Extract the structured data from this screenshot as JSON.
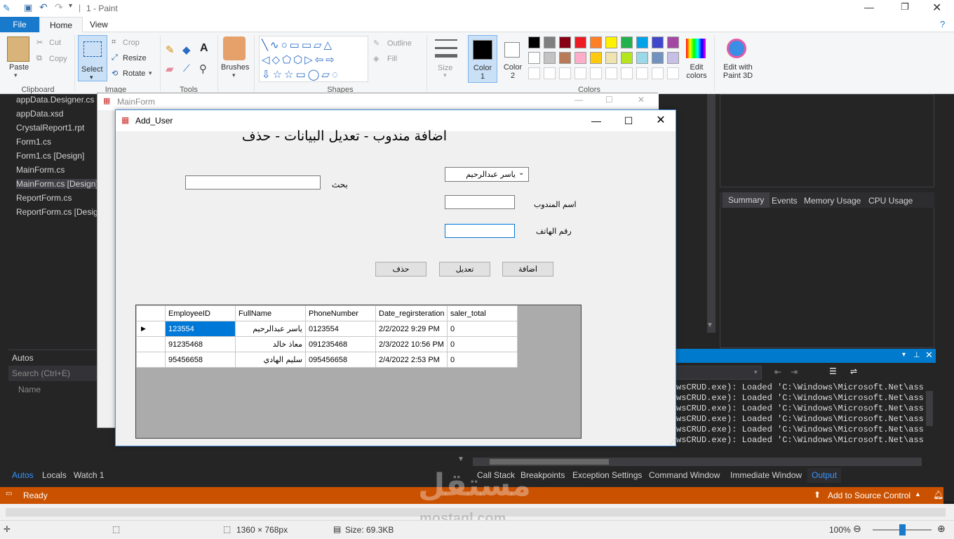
{
  "app": {
    "title": "1 - Paint"
  },
  "ribbon": {
    "tabs": [
      "File",
      "Home",
      "View"
    ],
    "clipboard": {
      "paste": "Paste",
      "cut": "Cut",
      "copy": "Copy",
      "label": "Clipboard"
    },
    "image": {
      "select": "Select",
      "crop": "Crop",
      "resize": "Resize",
      "rotate": "Rotate",
      "label": "Image"
    },
    "tools": {
      "label": "Tools"
    },
    "brushes": "Brushes",
    "shapes": {
      "label": "Shapes",
      "outline": "Outline",
      "fill": "Fill"
    },
    "size": "Size",
    "color1": "Color 1",
    "color2": "Color 2",
    "colors_label": "Colors",
    "edit_colors": "Edit colors",
    "edit_paint3d": "Edit with Paint 3D",
    "palette_row1": [
      "#000000",
      "#7f7f7f",
      "#880015",
      "#ed1c24",
      "#ff7f27",
      "#fff200",
      "#22b14c",
      "#00a2e8",
      "#3f48cc",
      "#a349a4"
    ],
    "palette_row2": [
      "#ffffff",
      "#c3c3c3",
      "#b97a57",
      "#ffaec9",
      "#ffc90e",
      "#efe4b0",
      "#b5e61d",
      "#99d9ea",
      "#7092be",
      "#c8bfe7"
    ]
  },
  "solution": {
    "files": [
      "appData.Designer.cs",
      "appData.xsd",
      "CrystalReport1.rpt",
      "Form1.cs",
      "Form1.cs [Design]",
      "MainForm.cs",
      "MainForm.cs [Design]",
      "ReportForm.cs",
      "ReportForm.cs [Design]"
    ]
  },
  "autos": {
    "title": "Autos",
    "search": "Search (Ctrl+E)",
    "col_name": "Name",
    "tabs": [
      "Autos",
      "Locals",
      "Watch 1"
    ]
  },
  "diag": {
    "tabs": [
      "Summary",
      "Events",
      "Memory Usage",
      "CPU Usage"
    ]
  },
  "mainform": {
    "title": "MainForm"
  },
  "adduser": {
    "title": "Add_User",
    "heading": "اضافة مندوب - تعديل البيانات - حذف",
    "search_label": "بحث",
    "combo_value": "ياسر عبدالرحيم",
    "name_label": "اسم المندوب",
    "phone_label": "رقم الهاتف",
    "btn_delete": "حذف",
    "btn_edit": "تعديل",
    "btn_add": "اضافة",
    "columns": [
      "EmployeeID",
      "FullName",
      "PhoneNumber",
      "Date_regirsteration",
      "saler_total"
    ],
    "rows": [
      [
        "123554",
        "ياسر عبدالرحيم",
        "0123554",
        "2/2/2022 9:29 PM",
        "0"
      ],
      [
        "91235468",
        "معاذ خالد",
        "091235468",
        "2/3/2022 10:56 PM",
        "0"
      ],
      [
        "95456658",
        "سليم الهادي",
        "095456658",
        "2/4/2022 2:53 PM",
        "0"
      ]
    ]
  },
  "output": {
    "lines": [
      "wsCRUD.exe): Loaded 'C:\\Windows\\Microsoft.Net\\asse",
      "wsCRUD.exe): Loaded 'C:\\Windows\\Microsoft.Net\\asse",
      "wsCRUD.exe): Loaded 'C:\\Windows\\Microsoft.Net\\asse",
      "wsCRUD.exe): Loaded 'C:\\Windows\\Microsoft.Net\\asse",
      "wsCRUD.exe): Loaded 'C:\\Windows\\Microsoft.Net\\asse",
      "wsCRUD.exe): Loaded 'C:\\Windows\\Microsoft.Net\\asse"
    ],
    "bottom_tabs": [
      "Call Stack",
      "Breakpoints",
      "Exception Settings",
      "Command Window",
      "Immediate Window",
      "Output"
    ]
  },
  "status": {
    "ready": "Ready",
    "source_control": "Add to Source Control"
  },
  "paint_status": {
    "dimensions": "1360 × 768px",
    "size": "Size: 69.3KB",
    "zoom": "100%"
  },
  "watermark": {
    "line1": "مستقل",
    "line2": "mostaql.com"
  }
}
